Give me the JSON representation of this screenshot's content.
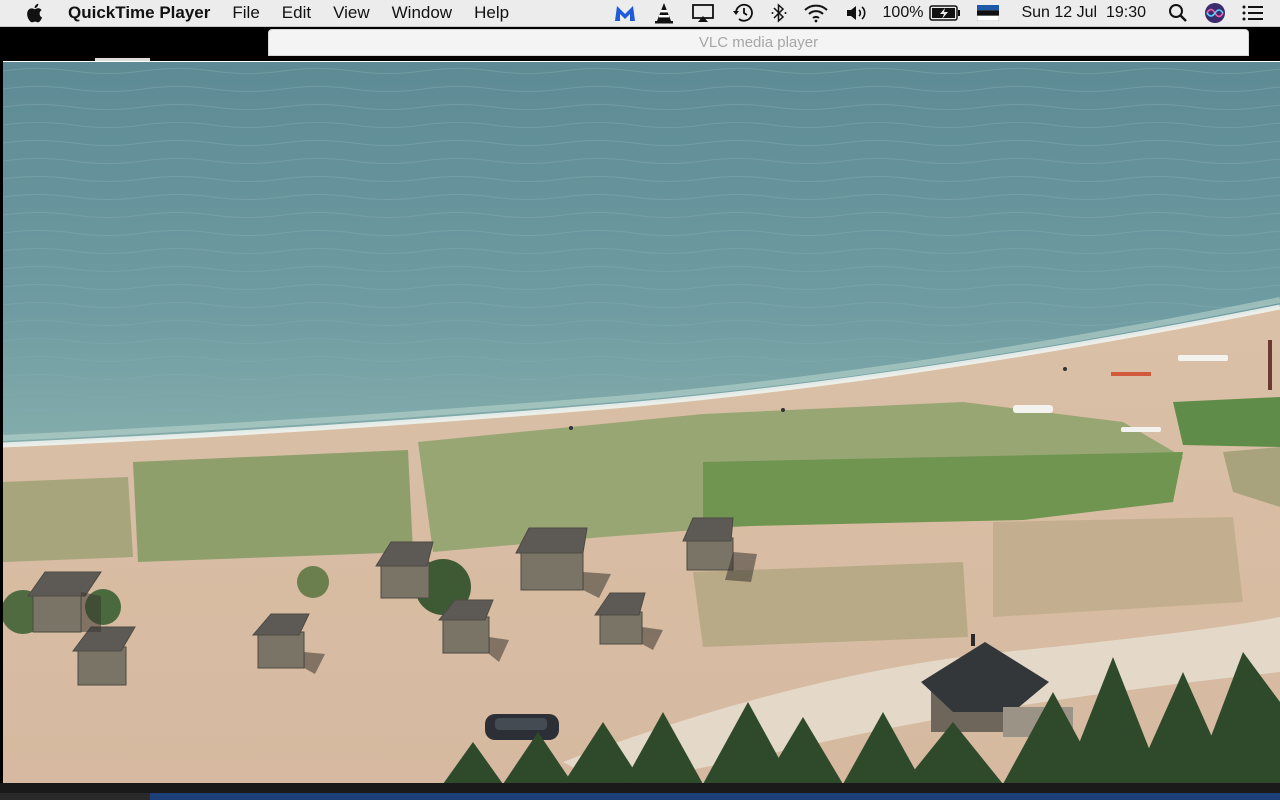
{
  "menubar": {
    "app_name": "QuickTime Player",
    "menus": [
      "File",
      "Edit",
      "View",
      "Window",
      "Help"
    ],
    "battery": "100%",
    "datetime": "Sun 12 Jul  19:30",
    "icons": [
      "apple-icon",
      "malwarebytes-icon",
      "vlc-cone-icon",
      "airplay-icon",
      "time-machine-icon",
      "bluetooth-icon",
      "wifi-icon",
      "volume-icon",
      "battery-icon",
      "flag-icon",
      "search-icon",
      "siri-icon",
      "control-center-icon"
    ]
  },
  "window": {
    "title": "VLC media player"
  },
  "colors": {
    "sea": "#6c9aa0",
    "sand": "#d8bca4",
    "grass": "#8b9f6a",
    "statusbar": "#1d3f78"
  }
}
